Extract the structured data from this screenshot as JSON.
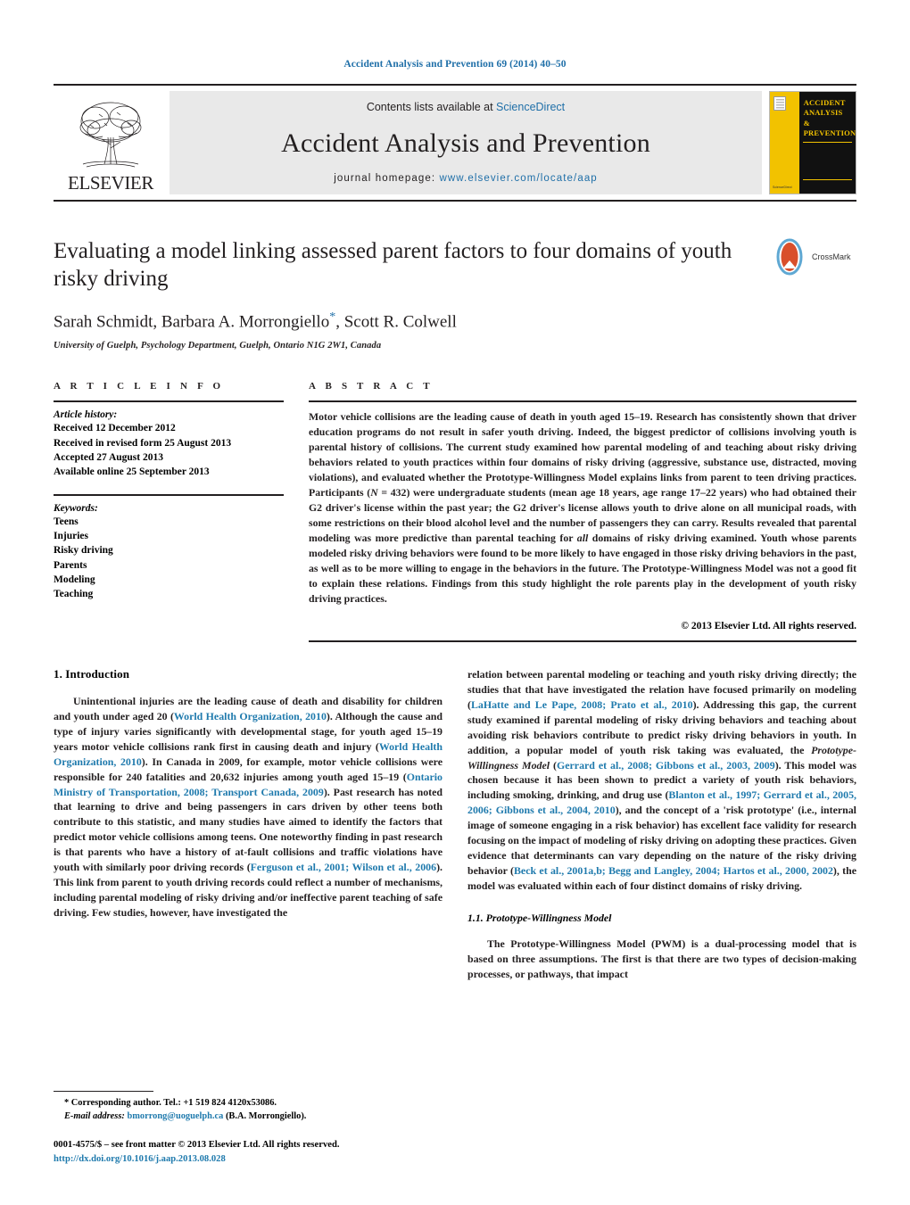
{
  "running_head": "Accident Analysis and Prevention 69 (2014) 40–50",
  "masthead": {
    "contents_prefix": "Contents lists available at ",
    "contents_link": "ScienceDirect",
    "journal_title": "Accident Analysis and Prevention",
    "homepage_prefix": "journal homepage: ",
    "homepage_url": "www.elsevier.com/locate/aap",
    "publisher_name": "ELSEVIER",
    "cover": {
      "line1": "ACCIDENT",
      "line2": "ANALYSIS",
      "line3": "&",
      "line4": "PREVENTION",
      "footer": "ScienceDirect"
    }
  },
  "title": "Evaluating a model linking assessed parent factors to four domains of youth risky driving",
  "authors": "Sarah Schmidt, Barbara A. Morrongiello",
  "authors_tail": ", Scott R. Colwell",
  "corresponding_marker": "*",
  "affiliation": "University of Guelph, Psychology Department, Guelph, Ontario N1G 2W1, Canada",
  "crossmark_label": "CrossMark",
  "article_info": {
    "heading": "A R T I C L E   I N F O",
    "history_title": "Article history:",
    "history": [
      "Received 12 December 2012",
      "Received in revised form 25 August 2013",
      "Accepted 27 August 2013",
      "Available online 25 September 2013"
    ],
    "keywords_title": "Keywords:",
    "keywords": [
      "Teens",
      "Injuries",
      "Risky driving",
      "Parents",
      "Modeling",
      "Teaching"
    ]
  },
  "abstract": {
    "heading": "A B S T R A C T",
    "part1": "Motor vehicle collisions are the leading cause of death in youth aged 15–19. Research has consistently shown that driver education programs do not result in safer youth driving. Indeed, the biggest predictor of collisions involving youth is parental history of collisions. The current study examined how parental modeling of and teaching about risky driving behaviors related to youth practices within four domains of risky driving (aggressive, substance use, distracted, moving violations), and evaluated whether the Prototype-Willingness Model explains links from parent to teen driving practices. Participants (",
    "n_italic": "N",
    "n_value": " = 432) were undergraduate students (mean age 18 years, age range 17–22 years) who had obtained their G2 driver's license within the past year; the G2 driver's license allows youth to drive alone on all municipal roads, with some restrictions on their blood alcohol level and the number of passengers they can carry. Results revealed that parental modeling was more predictive than parental teaching for ",
    "all_italic": "all",
    "part3": " domains of risky driving examined. Youth whose parents modeled risky driving behaviors were found to be more likely to have engaged in those risky driving behaviors in the past, as well as to be more willing to engage in the behaviors in the future. The Prototype-Willingness Model was not a good fit to explain these relations. Findings from this study highlight the role parents play in the development of youth risky driving practices.",
    "copyright": "© 2013 Elsevier Ltd. All rights reserved."
  },
  "body": {
    "intro_heading": "1.  Introduction",
    "left_p1_a": "Unintentional injuries are the leading cause of death and disability for children and youth under aged 20 (",
    "left_p1_r1": "World Health Organization, 2010",
    "left_p1_b": "). Although the cause and type of injury varies significantly with developmental stage, for youth aged 15–19 years motor vehicle collisions rank first in causing death and injury (",
    "left_p1_r2": "World Health Organization, 2010",
    "left_p1_c": "). In Canada in 2009, for example, motor vehicle collisions were responsible for 240 fatalities and 20,632 injuries among youth aged 15–19 (",
    "left_p1_r3": "Ontario Ministry of Transportation, 2008; Transport Canada, 2009",
    "left_p1_d": "). Past research has noted that learning to drive and being passengers in cars driven by other teens both contribute to this statistic, and many studies have aimed to identify the factors that predict motor vehicle collisions among teens. One noteworthy finding in past research is that parents who have a history of at-fault collisions and traffic violations have youth with similarly poor driving records (",
    "left_p1_r4": "Ferguson et al., 2001; Wilson et al., 2006",
    "left_p1_e": "). This link from parent to youth driving records could reflect a number of mechanisms, including parental modeling of risky driving and/or ineffective parent teaching of safe driving. Few studies, however, have investigated the",
    "right_p1_a": "relation between parental modeling or teaching and youth risky driving directly; the studies that that have investigated the relation have focused primarily on modeling (",
    "right_p1_r1": "LaHatte and Le Pape, 2008; Prato et al., 2010",
    "right_p1_b": "). Addressing this gap, the current study examined if parental modeling of risky driving behaviors and teaching about avoiding risk behaviors contribute to predict risky driving behaviors in youth. In addition, a popular model of youth risk taking was evaluated, the ",
    "right_p1_italic": "Prototype-Willingness Model",
    "right_p1_c": " (",
    "right_p1_r2": "Gerrard et al., 2008; Gibbons et al., 2003, 2009",
    "right_p1_d": "). This model was chosen because it has been shown to predict a variety of youth risk behaviors, including smoking, drinking, and drug use (",
    "right_p1_r3": "Blanton et al., 1997; Gerrard et al., 2005, 2006; Gibbons et al., 2004, 2010",
    "right_p1_e": "), and the concept of a 'risk prototype' (i.e., internal image of someone engaging in a risk behavior) has excellent face validity for research focusing on the impact of modeling of risky driving on adopting these practices. Given evidence that determinants can vary depending on the nature of the risky driving behavior (",
    "right_p1_r4": "Beck et al., 2001a,b; Begg and Langley, 2004; Hartos et al., 2000, 2002",
    "right_p1_f": "), the model was evaluated within each of four distinct domains of risky driving.",
    "sub_heading": "1.1.  Prototype-Willingness Model",
    "right_p2": "The Prototype-Willingness Model (PWM) is a dual-processing model that is based on three assumptions. The first is that there are two types of decision-making processes, or pathways, that impact"
  },
  "footnotes": {
    "corr_marker": "*",
    "corr_text": " Corresponding author. Tel.: +1 519 824 4120x53086.",
    "email_label": "E-mail address:",
    "email": "bmorrong@uoguelph.ca",
    "email_suffix": " (B.A. Morrongiello).",
    "issn_line": "0001-4575/$ – see front matter © 2013 Elsevier Ltd. All rights reserved.",
    "doi": "http://dx.doi.org/10.1016/j.aap.2013.08.028"
  },
  "colors": {
    "link": "#1f6fa8",
    "reference": "#1f7aad",
    "cover_yellow": "#f2c200",
    "masthead_gray": "#e9e9e9"
  }
}
